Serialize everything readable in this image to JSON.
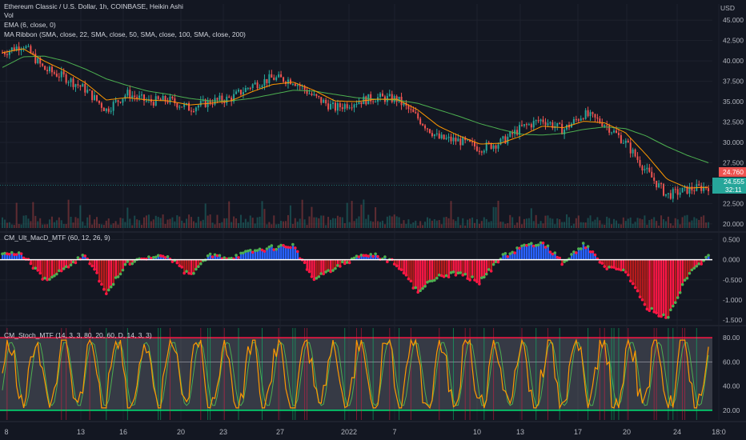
{
  "header": {
    "title": "Ethereum Classic / U.S. Dollar, 1h, COINBASE, Heikin Ashi",
    "vol": "Vol",
    "ema": "EMA (6, close, 0)",
    "ribbon": "MA Ribbon (SMA, close, 22, SMA, close, 50, SMA, close, 100, SMA, close, 200)",
    "currency": "USD"
  },
  "macd_panel": {
    "title": "CM_Ult_MacD_MTF (60, 12, 26, 9)"
  },
  "stoch_panel": {
    "title": "CM_Stoch_MTF (14, 3, 3, 80, 20, 60, D, 14, 3, 3)"
  },
  "badges": {
    "price_red": "24.760",
    "price_green": "24.555",
    "countdown": "32:11"
  },
  "colors": {
    "background": "#131722",
    "grid": "#1e222d",
    "up_candle": "#26a69a",
    "down_candle": "#ef5350",
    "ema": "#ff9800",
    "ribbon_fast": "#f57c00",
    "ribbon_slow": "#4caf50",
    "macd_up": "#4caf50",
    "macd_down": "#ff1744",
    "hist_blue": "#2962ff",
    "stoch_band": "#787b86",
    "stoch_line": "#ff9800"
  },
  "chart_data": [
    {
      "type": "line",
      "name": "price",
      "yticks": [
        "45.000",
        "42.500",
        "40.000",
        "37.500",
        "35.000",
        "32.500",
        "30.000",
        "27.500",
        "25.000",
        "22.500",
        "20.000"
      ],
      "ylim": [
        19.5,
        46
      ],
      "x_ticks": [
        "8",
        "13",
        "16",
        "20",
        "23",
        "27",
        "2022",
        "7",
        "10",
        "13",
        "17",
        "20",
        "24",
        "18:0"
      ],
      "x": [
        "8",
        "9",
        "10",
        "11",
        "13",
        "14",
        "16",
        "17",
        "18",
        "20",
        "21",
        "23",
        "24",
        "26",
        "27",
        "28",
        "30",
        "2022",
        "3",
        "5",
        "7",
        "8",
        "10",
        "11",
        "12",
        "13",
        "15",
        "17",
        "18",
        "19",
        "20",
        "21",
        "22",
        "23",
        "24"
      ],
      "close": [
        41.0,
        42.0,
        39.0,
        38.0,
        36.5,
        34.0,
        36.0,
        35.0,
        35.2,
        34.2,
        35.0,
        35.4,
        37.0,
        37.9,
        37.6,
        35.6,
        34.2,
        35.0,
        35.5,
        35.3,
        33.0,
        30.5,
        30.2,
        29.3,
        30.0,
        31.8,
        32.8,
        31.5,
        33.5,
        32.3,
        30.0,
        26.5,
        23.5,
        24.2,
        24.6
      ],
      "ema": [
        41.0,
        41.5,
        40.0,
        38.8,
        37.3,
        35.2,
        35.5,
        35.2,
        35.1,
        34.6,
        34.8,
        35.1,
        36.2,
        37.1,
        37.4,
        36.4,
        35.1,
        35.0,
        35.3,
        35.3,
        34.0,
        32.0,
        30.8,
        29.8,
        29.9,
        30.8,
        32.0,
        31.8,
        32.6,
        32.4,
        31.2,
        28.5,
        25.5,
        24.4,
        24.5
      ],
      "ma_slow": [
        39.2,
        40.5,
        40.6,
        40.0,
        39.0,
        37.8,
        37.0,
        36.3,
        35.9,
        35.4,
        35.1,
        35.1,
        35.4,
        35.9,
        36.4,
        36.3,
        35.9,
        35.5,
        35.3,
        35.2,
        34.8,
        34.0,
        33.2,
        32.3,
        31.6,
        31.0,
        30.9,
        31.1,
        31.6,
        31.9,
        31.7,
        30.8,
        29.5,
        28.4,
        27.5
      ]
    },
    {
      "type": "bar",
      "name": "macd",
      "yticks": [
        "0.500",
        "0.000",
        "-0.500",
        "-1.000",
        "-1.500"
      ],
      "ylim": [
        -1.6,
        0.65
      ],
      "values": [
        0.2,
        0.1,
        -0.5,
        -0.25,
        0.15,
        -0.8,
        -0.1,
        0.05,
        0.1,
        -0.4,
        0.1,
        0.05,
        0.2,
        0.3,
        0.35,
        -0.5,
        -0.2,
        0.05,
        0.1,
        -0.1,
        -0.8,
        -0.4,
        -0.35,
        -0.55,
        0.05,
        0.3,
        0.45,
        -0.1,
        0.4,
        -0.2,
        -0.3,
        -1.2,
        -1.45,
        -0.4,
        0.1
      ]
    },
    {
      "type": "line",
      "name": "stoch",
      "yticks": [
        "80.00",
        "60.00",
        "40.00",
        "20.00"
      ],
      "ylim": [
        12,
        88
      ],
      "upper": 80,
      "lower": 20,
      "mid": 60
    }
  ]
}
